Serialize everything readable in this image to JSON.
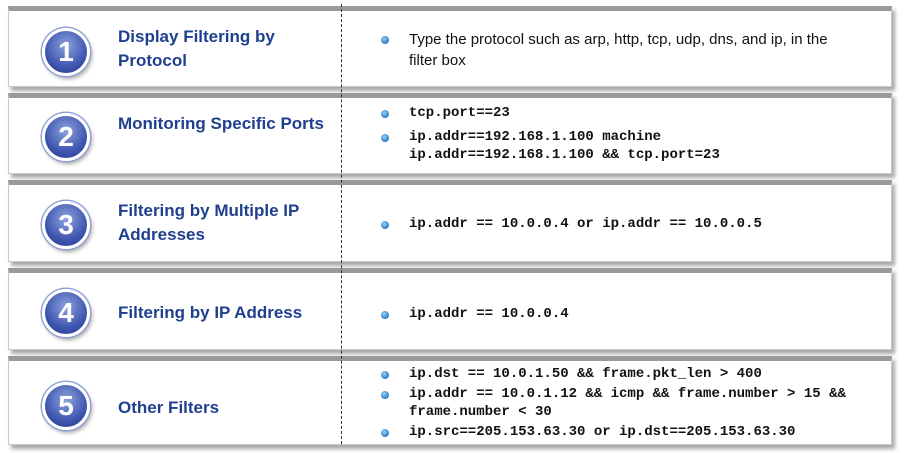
{
  "rows": [
    {
      "number": "1",
      "title": "Display Filtering by Protocol",
      "items": [
        "Type the protocol such as arp, http, tcp, udp, dns, and ip, in the filter box"
      ]
    },
    {
      "number": "2",
      "title": "Monitoring Specific Ports",
      "items": [
        "tcp.port==23",
        "ip.addr==192.168.1.100 machine ip.addr==192.168.1.100 && tcp.port=23"
      ]
    },
    {
      "number": "3",
      "title": "Filtering by Multiple IP Addresses",
      "items": [
        "ip.addr == 10.0.0.4 or ip.addr == 10.0.0.5"
      ]
    },
    {
      "number": "4",
      "title": "Filtering by IP Address",
      "items": [
        "ip.addr == 10.0.0.4"
      ]
    },
    {
      "number": "5",
      "title": "Other Filters",
      "items": [
        "ip.dst == 10.0.1.50 && frame.pkt_len > 400",
        "ip.addr == 10.0.1.12 && icmp && frame.number > 15 && frame.number < 30",
        "ip.src==205.153.63.30 or ip.dst==205.153.63.30"
      ]
    }
  ]
}
